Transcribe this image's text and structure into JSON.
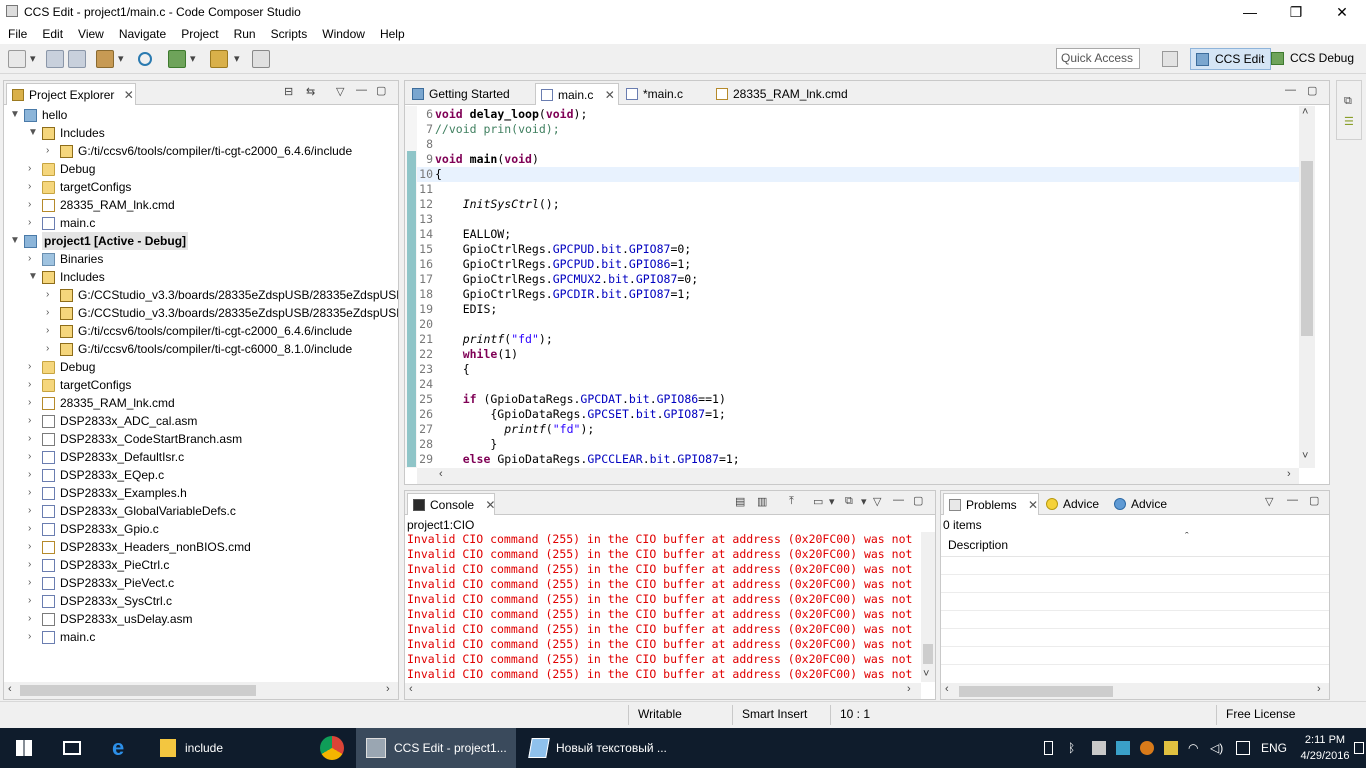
{
  "window": {
    "title": "CCS Edit - project1/main.c - Code Composer Studio",
    "min": "—",
    "max": "❐",
    "close": "✕"
  },
  "menu": [
    "File",
    "Edit",
    "View",
    "Navigate",
    "Project",
    "Run",
    "Scripts",
    "Window",
    "Help"
  ],
  "toolbar": {
    "quick_access": "Quick Access",
    "ccs_edit": "CCS Edit",
    "ccs_debug": "CCS Debug"
  },
  "project_explorer": {
    "title": "Project Explorer",
    "items": [
      {
        "label": "hello",
        "level": 0,
        "arrow": "▼",
        "icon": "proj",
        "bold": false
      },
      {
        "label": "Includes",
        "level": 1,
        "arrow": "▼",
        "icon": "inc"
      },
      {
        "label": "G:/ti/ccsv6/tools/compiler/ti-cgt-c2000_6.4.6/include",
        "level": 2,
        "arrow": "›",
        "icon": "inc"
      },
      {
        "label": "Debug",
        "level": 1,
        "arrow": "›",
        "icon": "folder"
      },
      {
        "label": "targetConfigs",
        "level": 1,
        "arrow": "›",
        "icon": "folder"
      },
      {
        "label": "28335_RAM_lnk.cmd",
        "level": 1,
        "arrow": "›",
        "icon": "filecmd"
      },
      {
        "label": "main.c",
        "level": 1,
        "arrow": "›",
        "icon": "filec"
      },
      {
        "label": "project1  [Active - Debug]",
        "level": 0,
        "arrow": "▼",
        "icon": "proj",
        "bold": true
      },
      {
        "label": "Binaries",
        "level": 1,
        "arrow": "›",
        "icon": "bin"
      },
      {
        "label": "Includes",
        "level": 1,
        "arrow": "▼",
        "icon": "inc"
      },
      {
        "label": "G:/CCStudio_v3.3/boards/28335eZdspUSB/28335eZdspUSB",
        "level": 2,
        "arrow": "›",
        "icon": "inc"
      },
      {
        "label": "G:/CCStudio_v3.3/boards/28335eZdspUSB/28335eZdspUSB",
        "level": 2,
        "arrow": "›",
        "icon": "inc"
      },
      {
        "label": "G:/ti/ccsv6/tools/compiler/ti-cgt-c2000_6.4.6/include",
        "level": 2,
        "arrow": "›",
        "icon": "inc"
      },
      {
        "label": "G:/ti/ccsv6/tools/compiler/ti-cgt-c6000_8.1.0/include",
        "level": 2,
        "arrow": "›",
        "icon": "inc"
      },
      {
        "label": "Debug",
        "level": 1,
        "arrow": "›",
        "icon": "folder"
      },
      {
        "label": "targetConfigs",
        "level": 1,
        "arrow": "›",
        "icon": "folder"
      },
      {
        "label": "28335_RAM_lnk.cmd",
        "level": 1,
        "arrow": "›",
        "icon": "filecmd"
      },
      {
        "label": "DSP2833x_ADC_cal.asm",
        "level": 1,
        "arrow": "›",
        "icon": "fileasm"
      },
      {
        "label": "DSP2833x_CodeStartBranch.asm",
        "level": 1,
        "arrow": "›",
        "icon": "fileasm"
      },
      {
        "label": "DSP2833x_DefaultIsr.c",
        "level": 1,
        "arrow": "›",
        "icon": "filec"
      },
      {
        "label": "DSP2833x_EQep.c",
        "level": 1,
        "arrow": "›",
        "icon": "filec"
      },
      {
        "label": "DSP2833x_Examples.h",
        "level": 1,
        "arrow": "›",
        "icon": "fileh"
      },
      {
        "label": "DSP2833x_GlobalVariableDefs.c",
        "level": 1,
        "arrow": "›",
        "icon": "filec"
      },
      {
        "label": "DSP2833x_Gpio.c",
        "level": 1,
        "arrow": "›",
        "icon": "filec"
      },
      {
        "label": "DSP2833x_Headers_nonBIOS.cmd",
        "level": 1,
        "arrow": "›",
        "icon": "filecmd"
      },
      {
        "label": "DSP2833x_PieCtrl.c",
        "level": 1,
        "arrow": "›",
        "icon": "filec"
      },
      {
        "label": "DSP2833x_PieVect.c",
        "level": 1,
        "arrow": "›",
        "icon": "filec"
      },
      {
        "label": "DSP2833x_SysCtrl.c",
        "level": 1,
        "arrow": "›",
        "icon": "filec"
      },
      {
        "label": "DSP2833x_usDelay.asm",
        "level": 1,
        "arrow": "›",
        "icon": "fileasm"
      },
      {
        "label": "main.c",
        "level": 1,
        "arrow": "›",
        "icon": "filec"
      }
    ]
  },
  "editor": {
    "tabs": [
      {
        "label": "Getting Started",
        "active": false
      },
      {
        "label": "main.c",
        "active": true
      },
      {
        "label": "*main.c",
        "active": false
      },
      {
        "label": "28335_RAM_lnk.cmd",
        "active": false
      }
    ],
    "lines": [
      {
        "n": "6",
        "html": "<span class='kw'>void</span> <b>delay_loop</b>(<span class='kw'>void</span>);"
      },
      {
        "n": "7",
        "html": "<span class='cm'>//void prin(void);</span>"
      },
      {
        "n": "8",
        "html": ""
      },
      {
        "n": "9",
        "html": "<span class='kw'>void</span> <b>main</b>(<span class='kw'>void</span>)"
      },
      {
        "n": "10",
        "html": "{"
      },
      {
        "n": "11",
        "html": ""
      },
      {
        "n": "12",
        "html": "    <i>InitSysCtrl</i>();"
      },
      {
        "n": "13",
        "html": ""
      },
      {
        "n": "14",
        "html": "    EALLOW;"
      },
      {
        "n": "15",
        "html": "    GpioCtrlRegs.<span class='fl'>GPCPUD</span>.<span class='fl'>bit</span>.<span class='fl'>GPIO87</span>=0;"
      },
      {
        "n": "16",
        "html": "    GpioCtrlRegs.<span class='fl'>GPCPUD</span>.<span class='fl'>bit</span>.<span class='fl'>GPIO86</span>=1;"
      },
      {
        "n": "17",
        "html": "    GpioCtrlRegs.<span class='fl'>GPCMUX2</span>.<span class='fl'>bit</span>.<span class='fl'>GPIO87</span>=0;"
      },
      {
        "n": "18",
        "html": "    GpioCtrlRegs.<span class='fl'>GPCDIR</span>.<span class='fl'>bit</span>.<span class='fl'>GPIO87</span>=1;"
      },
      {
        "n": "19",
        "html": "    EDIS;"
      },
      {
        "n": "20",
        "html": ""
      },
      {
        "n": "21",
        "html": "    <i>printf</i>(<span class='st'>\"fd\"</span>);"
      },
      {
        "n": "22",
        "html": "    <span class='kw'>while</span>(1)"
      },
      {
        "n": "23",
        "html": "    {"
      },
      {
        "n": "24",
        "html": ""
      },
      {
        "n": "25",
        "html": "    <span class='kw'>if</span> (GpioDataRegs.<span class='fl'>GPCDAT</span>.<span class='fl'>bit</span>.<span class='fl'>GPIO86</span>==1)"
      },
      {
        "n": "26",
        "html": "        {GpioDataRegs.<span class='fl'>GPCSET</span>.<span class='fl'>bit</span>.<span class='fl'>GPIO87</span>=1;"
      },
      {
        "n": "27",
        "html": "          <i>printf</i>(<span class='st'>\"fd\"</span>);"
      },
      {
        "n": "28",
        "html": "        }"
      },
      {
        "n": "29",
        "html": "    <span class='kw'>else</span> GpioDataRegs.<span class='fl'>GPCCLEAR</span>.<span class='fl'>bit</span>.<span class='fl'>GPIO87</span>=1;"
      }
    ]
  },
  "console": {
    "title": "Console",
    "subtitle": "project1:CIO",
    "lines": [
      "Invalid CIO command (255) in the CIO buffer at address (0x20FC00) was not",
      "Invalid CIO command (255) in the CIO buffer at address (0x20FC00) was not",
      "Invalid CIO command (255) in the CIO buffer at address (0x20FC00) was not",
      "Invalid CIO command (255) in the CIO buffer at address (0x20FC00) was not",
      "Invalid CIO command (255) in the CIO buffer at address (0x20FC00) was not",
      "Invalid CIO command (255) in the CIO buffer at address (0x20FC00) was not",
      "Invalid CIO command (255) in the CIO buffer at address (0x20FC00) was not",
      "Invalid CIO command (255) in the CIO buffer at address (0x20FC00) was not",
      "Invalid CIO command (255) in the CIO buffer at address (0x20FC00) was not",
      "Invalid CIO command (255) in the CIO buffer at address (0x20FC00) was not"
    ]
  },
  "problems": {
    "tab": "Problems",
    "advice1": "Advice",
    "advice2": "Advice",
    "count": "0 items",
    "column": "Description"
  },
  "status": {
    "writable": "Writable",
    "insert": "Smart Insert",
    "position": "10 : 1",
    "license": "Free License"
  },
  "taskbar": {
    "folder": "include",
    "ccs": "CCS Edit - project1...",
    "notepad": "Новый текстовый ...",
    "lang": "ENG",
    "time": "2:11 PM",
    "date": "4/29/2016"
  }
}
